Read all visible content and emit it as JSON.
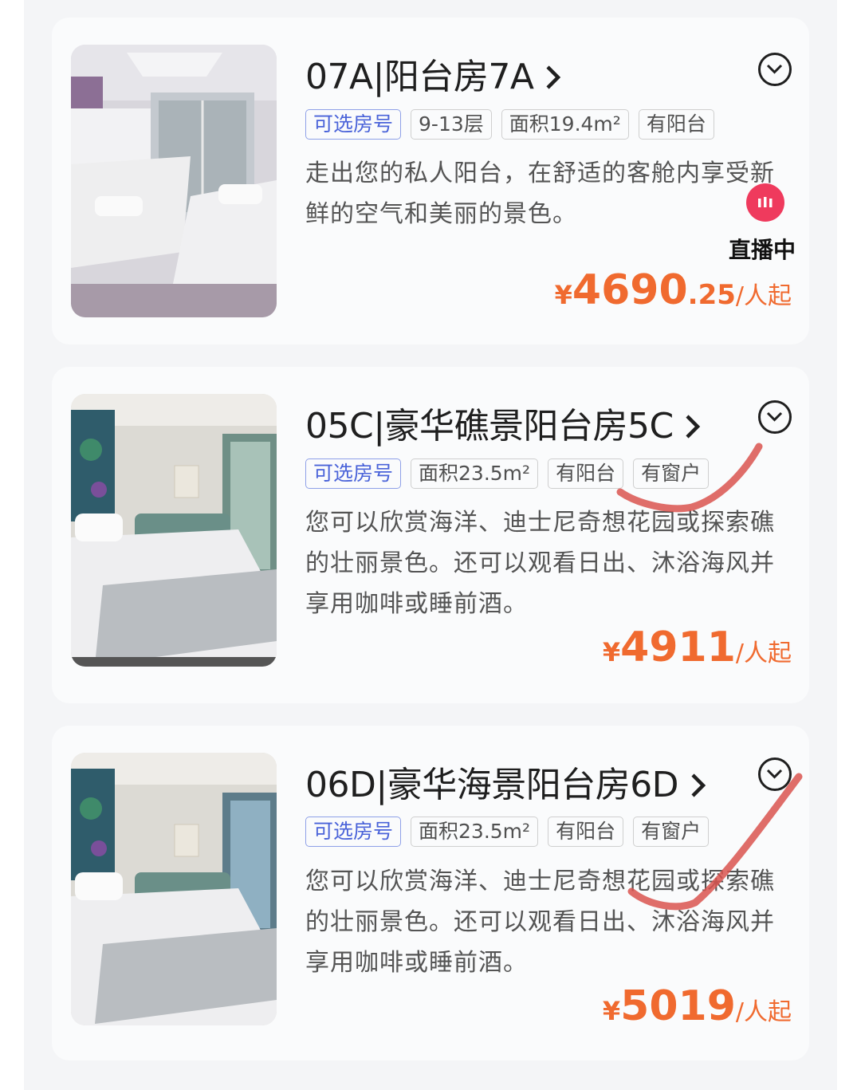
{
  "cabins": [
    {
      "title": "07A|阳台房7A",
      "tags": [
        "可选房号",
        "9-13层",
        "面积19.4m²",
        "有阳台"
      ],
      "description": "走出您的私人阳台，在舒适的客舱内享受新鲜的空气和美丽的景色。",
      "price": {
        "currency": "¥",
        "integer": "4690",
        "decimal": ".25",
        "unit": "/人起"
      }
    },
    {
      "title": "05C|豪华礁景阳台房5C",
      "tags": [
        "可选房号",
        "面积23.5m²",
        "有阳台",
        "有窗户"
      ],
      "description": "您可以欣赏海洋、迪士尼奇想花园或探索礁的壮丽景色。还可以观看日出、沐浴海风并享用咖啡或睡前酒。",
      "price": {
        "currency": "¥",
        "integer": "4911",
        "decimal": "",
        "unit": "/人起"
      }
    },
    {
      "title": "06D|豪华海景阳台房6D",
      "tags": [
        "可选房号",
        "面积23.5m²",
        "有阳台",
        "有窗户"
      ],
      "description": "您可以欣赏海洋、迪士尼奇想花园或探索礁的壮丽景色。还可以观看日出、沐浴海风并享用咖啡或睡前酒。",
      "price": {
        "currency": "¥",
        "integer": "5019",
        "decimal": "",
        "unit": "/人起"
      }
    }
  ],
  "live_badge": {
    "label": "直播中"
  },
  "icons": {
    "expand": "chevron-down-circle-icon",
    "title_arrow": "chevron-right-icon",
    "live": "live-bars-icon"
  },
  "colors": {
    "price": "#f06a2f",
    "tag_primary": "#4a63d9",
    "live": "#ef3a5d",
    "annotation": "#d9534f"
  }
}
